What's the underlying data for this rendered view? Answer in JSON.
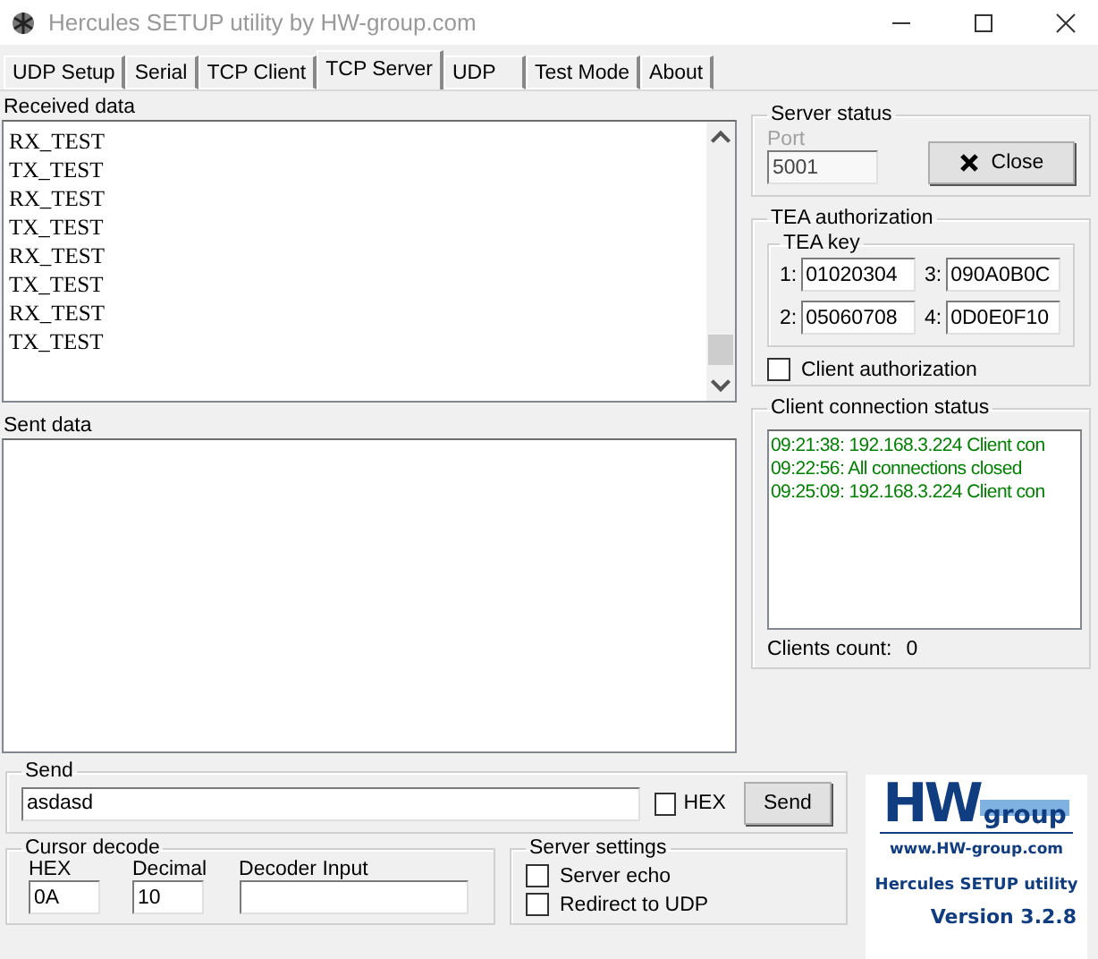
{
  "window": {
    "title": "Hercules SETUP utility by HW-group.com"
  },
  "tabs": [
    {
      "label": "UDP Setup",
      "selected": false
    },
    {
      "label": "Serial",
      "selected": false
    },
    {
      "label": "TCP Client",
      "selected": false
    },
    {
      "label": "TCP Server",
      "selected": true
    },
    {
      "label": "UDP",
      "selected": false
    },
    {
      "label": "Test Mode",
      "selected": false
    },
    {
      "label": "About",
      "selected": false
    }
  ],
  "received_data": {
    "label": "Received data",
    "lines": [
      "RX_TEST",
      "TX_TEST",
      "RX_TEST",
      "TX_TEST",
      "RX_TEST",
      "TX_TEST",
      "RX_TEST",
      "TX_TEST"
    ]
  },
  "sent_data": {
    "label": "Sent data"
  },
  "server_status": {
    "title": "Server status",
    "port_label": "Port",
    "port_value": "5001",
    "disabled": true,
    "close_button": "Close"
  },
  "tea_authorization": {
    "title": "TEA authorization",
    "key_title": "TEA key",
    "keys": [
      {
        "index": "1:",
        "value": "01020304"
      },
      {
        "index": "3:",
        "value": "090A0B0C"
      },
      {
        "index": "2:",
        "value": "05060708"
      },
      {
        "index": "4:",
        "value": "0D0E0F10"
      }
    ],
    "client_authorization": {
      "label": "Client authorization",
      "checked": false
    }
  },
  "client_connection_status": {
    "title": "Client connection status",
    "log": [
      "09:21:38:  192.168.3.224 Client con",
      "09:22:56:  All connections closed",
      "09:25:09:  192.168.3.224 Client con"
    ],
    "clients_count_label": "Clients count:",
    "clients_count": "0"
  },
  "send": {
    "title": "Send",
    "value": "asdasd",
    "hex": {
      "label": "HEX",
      "checked": false
    },
    "button": "Send"
  },
  "cursor_decode": {
    "title": "Cursor decode",
    "fields": [
      {
        "label": "HEX",
        "value": "0A"
      },
      {
        "label": "Decimal",
        "value": "10"
      },
      {
        "label": "Decoder Input"
      }
    ]
  },
  "server_settings": {
    "title": "Server settings",
    "options": [
      {
        "label": "Server echo",
        "checked": false
      },
      {
        "label": "Redirect to UDP",
        "checked": false
      }
    ]
  },
  "logo": {
    "brand": "HW",
    "brand_suffix": "group",
    "url": "www.HW-group.com",
    "product": "Hercules SETUP utility",
    "version": "Version  3.2.8"
  }
}
